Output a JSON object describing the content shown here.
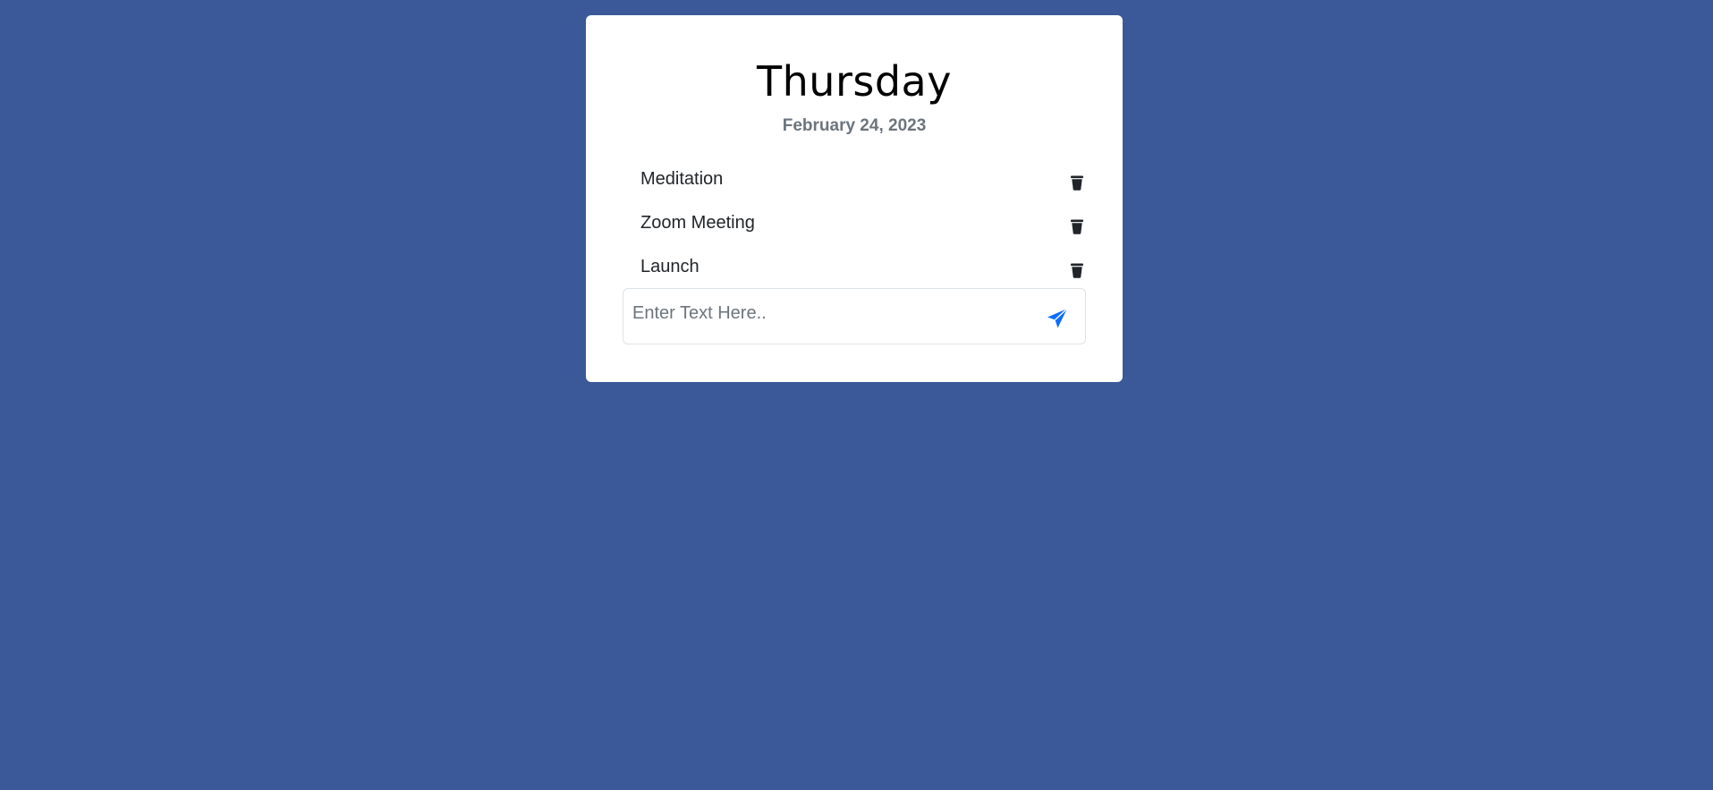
{
  "header": {
    "day": "Thursday",
    "date": "February 24, 2023"
  },
  "tasks": [
    {
      "label": "Meditation",
      "icon": "trash-icon"
    },
    {
      "label": "Zoom Meeting",
      "icon": "trash-icon"
    },
    {
      "label": "Launch",
      "icon": "trash-icon"
    }
  ],
  "composer": {
    "placeholder": "Enter Text Here..",
    "value": "",
    "submit_icon": "paper-plane-icon"
  },
  "colors": {
    "background": "#3b5998",
    "card": "#ffffff",
    "date_text": "#6c757d",
    "task_text": "#212529",
    "trash_icon": "#212529",
    "send_icon": "#0d6efd"
  }
}
